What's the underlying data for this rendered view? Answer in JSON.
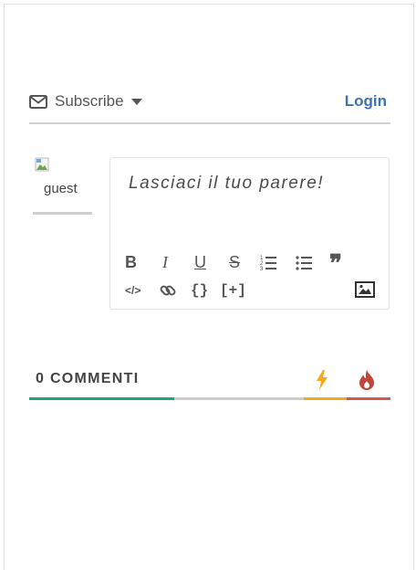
{
  "subscribe": {
    "label": "Subscribe",
    "icon": "envelope-icon"
  },
  "login": {
    "label": "Login"
  },
  "avatar": {
    "alt": "guest"
  },
  "editor": {
    "placeholder": "Lasciaci il tuo parere!",
    "toolbar": {
      "bold": "B",
      "italic": "I",
      "underline": "U",
      "strike": "S",
      "quote": "❞",
      "code": "</>",
      "braces": "{}",
      "spoiler": "[+]"
    }
  },
  "comments": {
    "count_label": "0 COMMENTI",
    "colors": {
      "green": "#1aa67e",
      "gray": "#cccccc",
      "orange": "#f6a91b",
      "red": "#d9534f"
    }
  }
}
